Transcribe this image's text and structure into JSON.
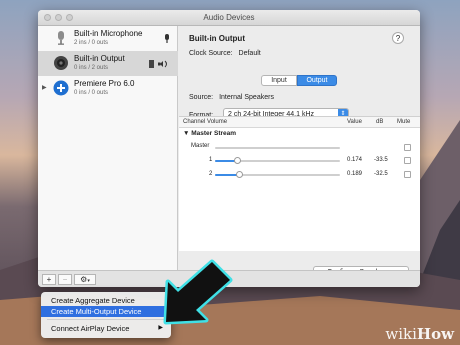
{
  "window": {
    "title": "Audio Devices"
  },
  "sidebar": {
    "devices": [
      {
        "name": "Built-in Microphone",
        "sub": "2 ins / 0 outs",
        "icon": "microphone-icon",
        "right_icon": "microphone-small-icon"
      },
      {
        "name": "Built-in Output",
        "sub": "0 ins / 2 outs",
        "icon": "speaker-icon",
        "right_icon": "output-speaker-icon"
      },
      {
        "name": "Premiere Pro 6.0",
        "sub": "0 ins / 0 outs",
        "icon": "plus-circle-icon"
      }
    ]
  },
  "detail": {
    "device_name": "Built-in Output",
    "help": "?",
    "clock_label": "Clock Source:",
    "clock_value": "Default",
    "tab_input": "Input",
    "tab_output": "Output",
    "source_label": "Source:",
    "source_value": "Internal Speakers",
    "format_label": "Format:",
    "format_value": "2 ch 24-bit Integer 44.1 kHz"
  },
  "table": {
    "headers": {
      "channel": "Channel Volume",
      "value": "Value",
      "db": "dB",
      "mute": "Mute"
    },
    "stream": "Master Stream",
    "rows": [
      {
        "label": "Master",
        "value": "",
        "db": "",
        "level": 0.0
      },
      {
        "label": "1",
        "value": "0.174",
        "db": "-33.5",
        "level": 0.174
      },
      {
        "label": "2",
        "value": "0.189",
        "db": "-32.5",
        "level": 0.189
      }
    ]
  },
  "buttons": {
    "configure": "Configure Speakers...",
    "add": "+",
    "remove": "−",
    "gear": "⚙"
  },
  "menu": {
    "items": [
      {
        "label": "Create Aggregate Device"
      },
      {
        "label": "Create Multi-Output Device"
      },
      {
        "label": "Connect AirPlay Device"
      }
    ],
    "submenu_arrow": "▶"
  },
  "watermark": {
    "prefix": "wiki",
    "suffix": "How"
  },
  "colors": {
    "accent": "#3b8be6",
    "highlight": "#2f6fe0",
    "arrow_outline": "#3fe0e6"
  }
}
